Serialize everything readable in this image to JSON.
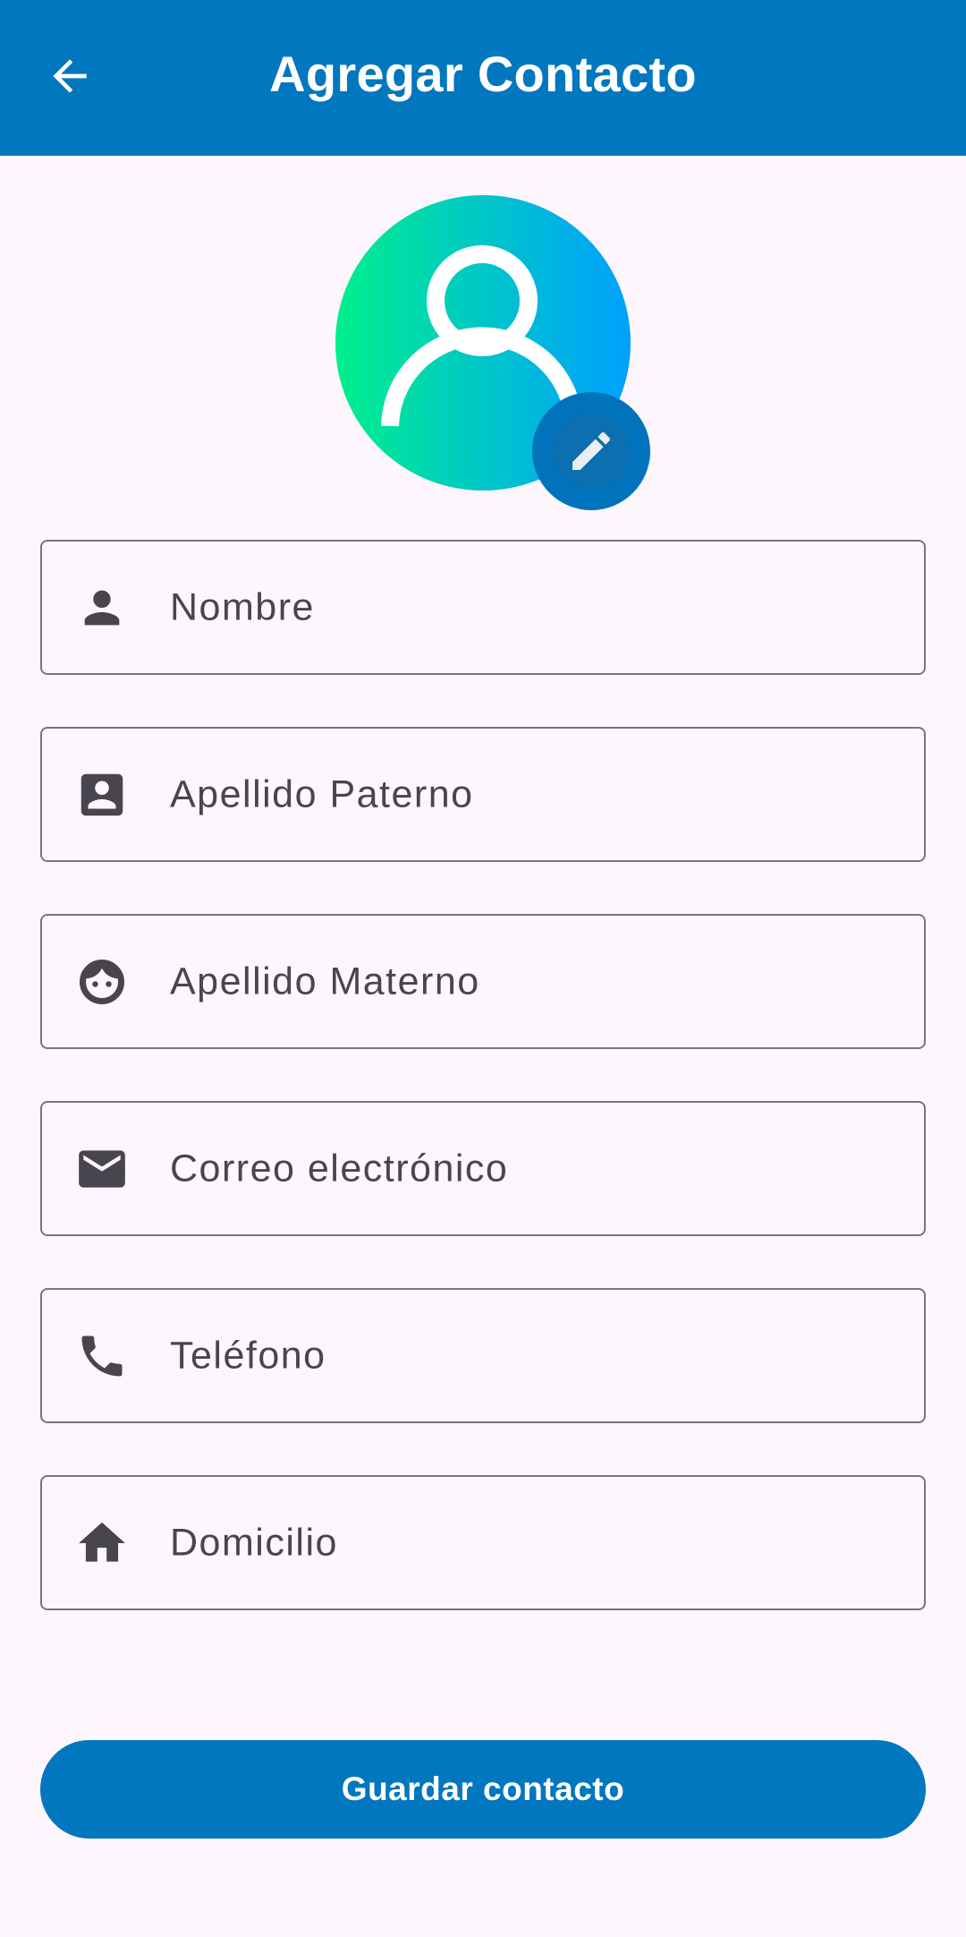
{
  "header": {
    "title": "Agregar Contacto",
    "back_icon": "arrow-back-icon"
  },
  "avatar": {
    "icon": "person-outline-icon",
    "edit_icon": "pencil-icon",
    "gradient": [
      "#00F08A",
      "#00C6C8",
      "#00A0FF"
    ]
  },
  "form": {
    "fields": [
      {
        "placeholder": "Nombre",
        "icon": "person-icon"
      },
      {
        "placeholder": "Apellido Paterno",
        "icon": "contact-card-icon"
      },
      {
        "placeholder": "Apellido Materno",
        "icon": "face-icon"
      },
      {
        "placeholder": "Correo electrónico",
        "icon": "email-icon"
      },
      {
        "placeholder": "Teléfono",
        "icon": "phone-icon"
      },
      {
        "placeholder": "Domicilio",
        "icon": "home-icon"
      }
    ]
  },
  "actions": {
    "save_label": "Guardar contacto"
  },
  "colors": {
    "primary": "#0077BE",
    "background": "#FDF7FD",
    "outline": "#79747E",
    "icon": "#49454F"
  }
}
